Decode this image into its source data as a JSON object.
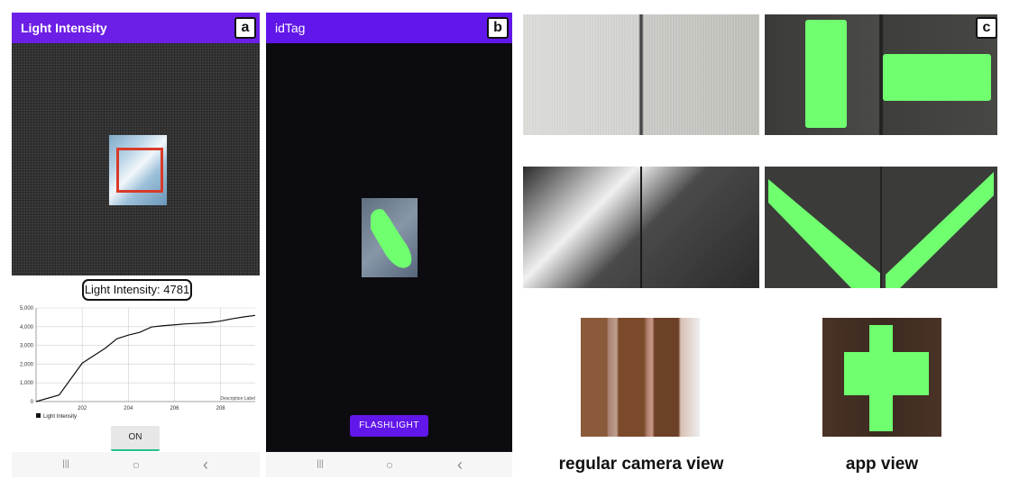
{
  "panels": {
    "a": {
      "tag": "a",
      "app_title": "Light Intensity",
      "readout": "Light Intensity: 4781",
      "button_label": "ON"
    },
    "b": {
      "tag": "b",
      "app_title": "idTag",
      "button_label": "FLASHLIGHT"
    },
    "c": {
      "tag": "c",
      "caption_left": "regular camera view",
      "caption_right": "app view"
    }
  },
  "nav_icons": [
    "recent-apps-icon",
    "home-icon",
    "back-icon"
  ],
  "nav_glyphs": {
    "recent": "|||",
    "home": "○",
    "back": "‹"
  },
  "colors": {
    "appbar": "#6c1fe6",
    "button": "#6c1fe6",
    "highlight": "#6fff6f",
    "marker": "#d83a2a"
  },
  "chart_data": {
    "type": "line",
    "title": "",
    "xlabel": "",
    "ylabel": "",
    "x": [
      200.0,
      201.0,
      202.0,
      203.0,
      203.5,
      204.0,
      204.5,
      205.0,
      205.5,
      206.0,
      206.5,
      207.0,
      207.5,
      208.0,
      208.5,
      209.0,
      209.5
    ],
    "series": [
      {
        "name": "Light Intensity",
        "values": [
          0,
          350,
          2050,
          2850,
          3350,
          3550,
          3700,
          3980,
          4050,
          4100,
          4150,
          4180,
          4220,
          4300,
          4420,
          4520,
          4600
        ]
      }
    ],
    "xticks": [
      "202",
      "204",
      "206",
      "208"
    ],
    "yticks": [
      "0",
      "1,000",
      "2,000",
      "3,000",
      "4,000",
      "5,000"
    ],
    "xlim": [
      200,
      209.5
    ],
    "ylim": [
      0,
      5000
    ],
    "grid": true,
    "legend": "bottom-left",
    "description_label": "Description Label"
  }
}
